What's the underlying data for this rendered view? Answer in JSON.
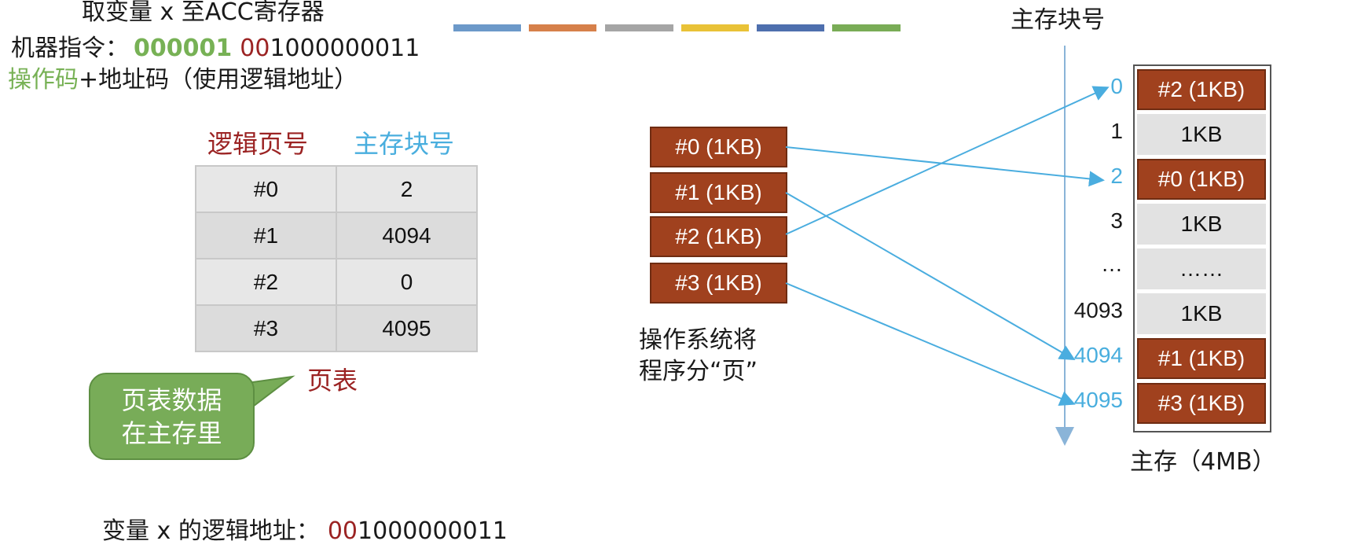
{
  "instruction": {
    "line1": "取变量 x 至ACC寄存器",
    "line2_label": "机器指令：",
    "line2_opcode": "000001",
    "line2_addr_red": "00",
    "line2_addr_rest": "1000000011",
    "line3_op": "操作码",
    "line3_rest": "+地址码（使用逻辑地址）"
  },
  "colors": [
    "#6c99c9",
    "#d6804a",
    "#a5a5a5",
    "#e9c237",
    "#4e6fae",
    "#79ac56"
  ],
  "page_table": {
    "header_logical": "逻辑页号",
    "header_block": "主存块号",
    "rows": [
      {
        "page": "#0",
        "block": "2"
      },
      {
        "page": "#1",
        "block": "4094"
      },
      {
        "page": "#2",
        "block": "0"
      },
      {
        "page": "#3",
        "block": "4095"
      }
    ],
    "label": "页表"
  },
  "callout": {
    "line1": "页表数据",
    "line2": "在主存里"
  },
  "program_pages": [
    "#0 (1KB)",
    "#1 (1KB)",
    "#2 (1KB)",
    "#3 (1KB)"
  ],
  "program_caption": {
    "line1": "操作系统将",
    "line2": "程序分“页”"
  },
  "memory": {
    "header": "主存块号",
    "caption": "主存（4MB）",
    "blocks": [
      {
        "num": "0",
        "content": "#2 (1KB)",
        "used": true
      },
      {
        "num": "1",
        "content": "1KB",
        "used": false
      },
      {
        "num": "2",
        "content": "#0 (1KB)",
        "used": true
      },
      {
        "num": "3",
        "content": "1KB",
        "used": false
      },
      {
        "num": "…",
        "content": "……",
        "used": false
      },
      {
        "num": "4093",
        "content": "1KB",
        "used": false
      },
      {
        "num": "4094",
        "content": "#1 (1KB)",
        "used": true
      },
      {
        "num": "4095",
        "content": "#3 (1KB)",
        "used": true
      }
    ]
  },
  "variable": {
    "label": "变量 x 的逻辑地址：",
    "addr_red": "00",
    "addr_rest": "1000000011"
  }
}
